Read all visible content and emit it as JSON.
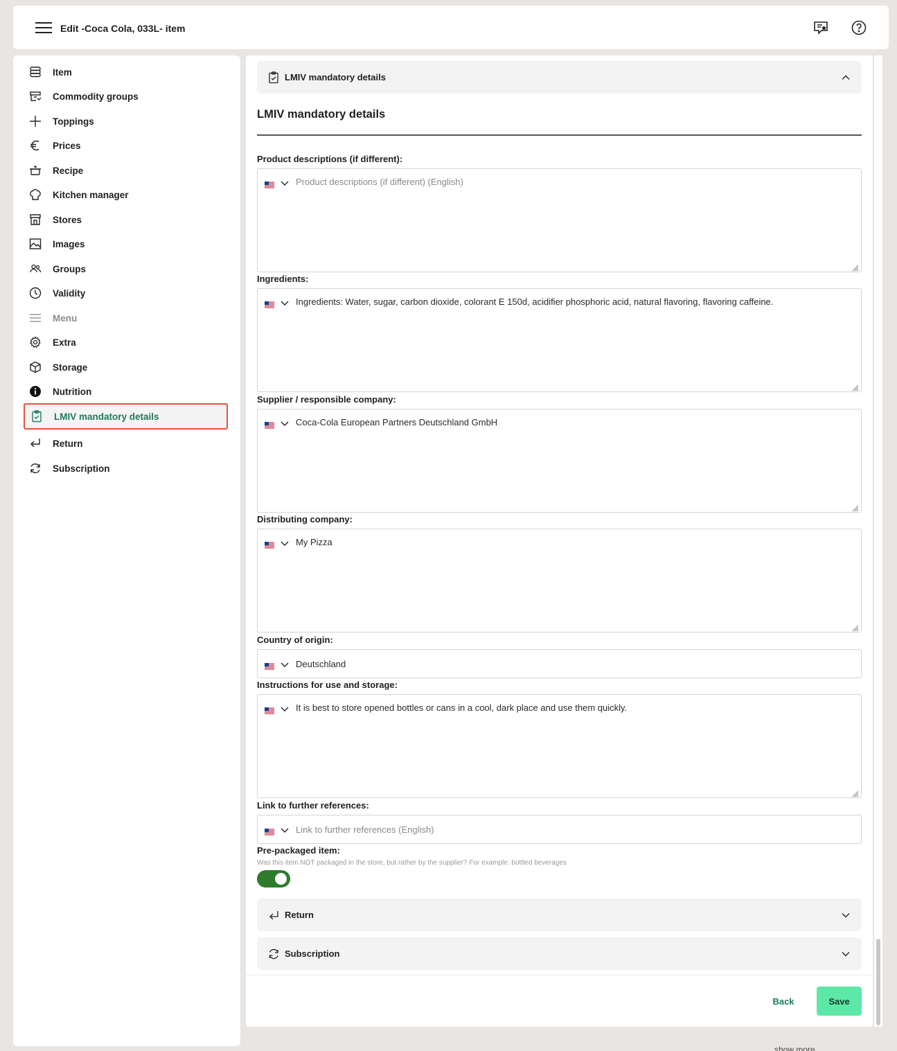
{
  "header": {
    "title": "Edit -Coca Cola, 033L- item"
  },
  "sidebar": {
    "items": [
      {
        "label": "Item",
        "icon": "database-icon"
      },
      {
        "label": "Commodity groups",
        "icon": "commodity-icon"
      },
      {
        "label": "Toppings",
        "icon": "plus-icon"
      },
      {
        "label": "Prices",
        "icon": "euro-icon"
      },
      {
        "label": "Recipe",
        "icon": "pot-icon"
      },
      {
        "label": "Kitchen manager",
        "icon": "chef-hat-icon"
      },
      {
        "label": "Stores",
        "icon": "store-icon"
      },
      {
        "label": "Images",
        "icon": "image-icon"
      },
      {
        "label": "Groups",
        "icon": "users-icon"
      },
      {
        "label": "Validity",
        "icon": "clock-icon"
      },
      {
        "label": "Menu",
        "icon": "menu-lines-icon"
      },
      {
        "label": "Extra",
        "icon": "gear-icon"
      },
      {
        "label": "Storage",
        "icon": "box-icon"
      },
      {
        "label": "Nutrition",
        "icon": "info-icon"
      },
      {
        "label": "LMIV mandatory details",
        "icon": "clipboard-check-icon"
      },
      {
        "label": "Return",
        "icon": "return-arrow-icon"
      },
      {
        "label": "Subscription",
        "icon": "refresh-icon"
      }
    ],
    "active_color": "#1d7a5f",
    "active_border_color": "#e5533d"
  },
  "main": {
    "accordion_title": "LMIV mandatory details",
    "section_title": "LMIV mandatory details",
    "fields": {
      "product_descriptions": {
        "label": "Product descriptions (if different):",
        "value": "",
        "placeholder": "Product descriptions (if different) (English)"
      },
      "ingredients": {
        "label": "Ingredients:",
        "value": "Ingredients: Water, sugar, carbon dioxide, colorant E 150d, acidifier phosphoric acid, natural flavoring, flavoring caffeine."
      },
      "supplier": {
        "label": "Supplier / responsible company:",
        "value": "Coca-Cola European Partners Deutschland GmbH"
      },
      "distributing": {
        "label": "Distributing company:",
        "value": "My Pizza"
      },
      "country": {
        "label": "Country of origin:",
        "value": "Deutschland"
      },
      "instructions": {
        "label": "Instructions for use and storage:",
        "value": "It is best to store opened bottles or cans in a cool, dark place and use them quickly."
      },
      "link": {
        "label": "Link to further references:",
        "value": "",
        "placeholder": "Link to further references (English)"
      }
    },
    "prepackaged": {
      "label": "Pre-packaged item:",
      "hint": "Was this item NOT packaged in the store, but rather by the supplier? For example: bottled beverages",
      "enabled": true,
      "color": "#2f7b2c"
    },
    "accordion_return": "Return",
    "accordion_subscription": "Subscription",
    "buttons": {
      "back": "Back",
      "save": "Save",
      "save_color": "#5ee8a8"
    }
  },
  "footer": {
    "show_more": "show more"
  }
}
